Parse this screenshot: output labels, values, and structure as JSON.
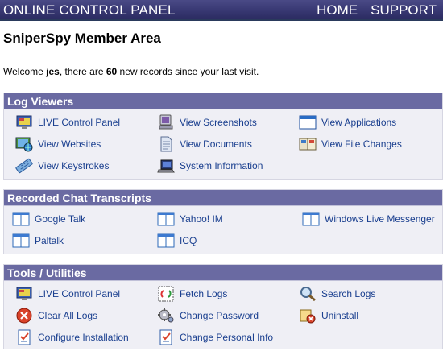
{
  "header": {
    "brand": "ONLINE CONTROL PANEL",
    "nav": [
      "HOME",
      "SUPPORT"
    ]
  },
  "page_title": "SniperSpy Member Area",
  "welcome": {
    "prefix": "Welcome ",
    "user": "jes",
    "middle": ", there are ",
    "count": "60",
    "suffix": " new records since your last visit."
  },
  "sections": [
    {
      "title": "Log Viewers",
      "items": [
        {
          "label": "LIVE Control Panel",
          "icon": "monitor-icon"
        },
        {
          "label": "View Screenshots",
          "icon": "screenshot-icon"
        },
        {
          "label": "View Applications",
          "icon": "window-icon"
        },
        {
          "label": "View Websites",
          "icon": "globe-monitor-icon"
        },
        {
          "label": "View Documents",
          "icon": "document-icon"
        },
        {
          "label": "View File Changes",
          "icon": "book-icon"
        },
        {
          "label": "View Keystrokes",
          "icon": "keyboard-icon"
        },
        {
          "label": "System Information",
          "icon": "laptop-icon"
        }
      ]
    },
    {
      "title": "Recorded Chat Transcripts",
      "items": [
        {
          "label": "Google Talk",
          "icon": "chat-window-icon"
        },
        {
          "label": "Yahoo! IM",
          "icon": "chat-window-icon"
        },
        {
          "label": "Windows Live Messenger",
          "icon": "chat-window-icon"
        },
        {
          "label": "Paltalk",
          "icon": "chat-window-icon"
        },
        {
          "label": "ICQ",
          "icon": "chat-window-icon"
        }
      ]
    },
    {
      "title": "Tools / Utilities",
      "items": [
        {
          "label": "LIVE Control Panel",
          "icon": "monitor-icon"
        },
        {
          "label": "Fetch Logs",
          "icon": "refresh-icon"
        },
        {
          "label": "Search Logs",
          "icon": "magnifier-icon"
        },
        {
          "label": "Clear All Logs",
          "icon": "delete-icon"
        },
        {
          "label": "Change Password",
          "icon": "gear-icon"
        },
        {
          "label": "Uninstall",
          "icon": "uninstall-icon"
        },
        {
          "label": "Configure Installation",
          "icon": "checklist-icon"
        },
        {
          "label": "Change Personal Info",
          "icon": "checklist-icon"
        }
      ]
    }
  ],
  "colors": {
    "header_bg": "#3b3b76",
    "section_header_bg": "#6a6aa2",
    "section_body_bg": "#efeff5",
    "link": "#1a3f8f"
  }
}
